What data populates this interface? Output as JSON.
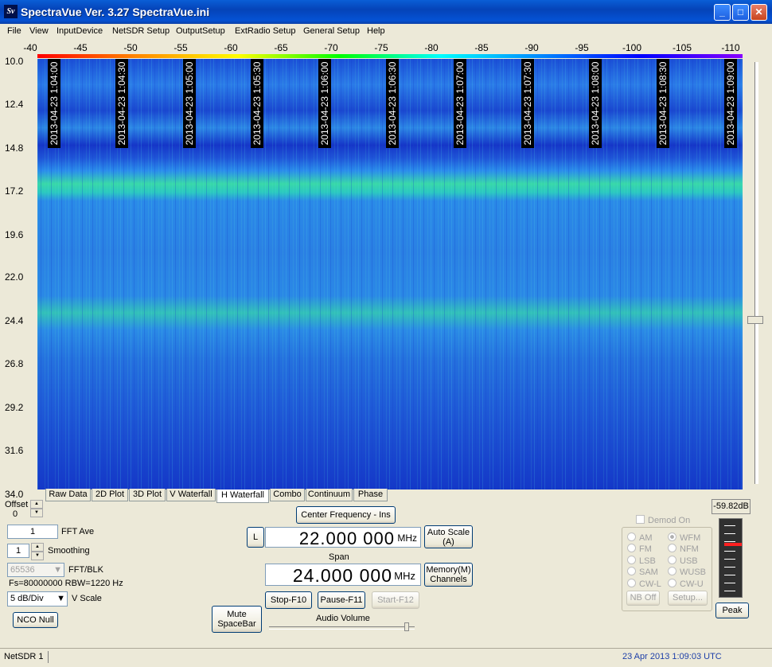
{
  "window": {
    "title": "SpectraVue Ver. 3.27  SpectraVue.ini",
    "icon_text": "Sv",
    "buttons": [
      "minimize-icon",
      "maximize-icon",
      "close-icon"
    ]
  },
  "menu": [
    "File",
    "View",
    "InputDevice",
    "NetSDR Setup",
    "OutputSetup",
    "ExtRadio Setup",
    "General Setup",
    "Help"
  ],
  "freq_axis": [
    "-40",
    "-45",
    "-50",
    "-55",
    "-60",
    "-65",
    "-70",
    "-75",
    "-80",
    "-85",
    "-90",
    "-95",
    "-100",
    "-105",
    "-110"
  ],
  "y_axis": [
    "10.0",
    "12.4",
    "14.8",
    "17.2",
    "19.6",
    "22.0",
    "24.4",
    "26.8",
    "29.2",
    "31.6",
    "34.0"
  ],
  "timestamps": [
    "2013-04-23 1:04:00",
    "2013-04-23 1:04:30",
    "2013-04-23 1:05:00",
    "2013-04-23 1:05:30",
    "2013-04-23 1:06:00",
    "2013-04-23 1:06:30",
    "2013-04-23 1:07:00",
    "2013-04-23 1:07:30",
    "2013-04-23 1:08:00",
    "2013-04-23 1:08:30",
    "2013-04-23 1:09:00"
  ],
  "tabs": [
    "Raw Data",
    "2D Plot",
    "3D Plot",
    "V Waterfall",
    "H Waterfall",
    "Combo",
    "Continuum",
    "Phase"
  ],
  "active_tab": "H Waterfall",
  "controls": {
    "offset_label": "Offset",
    "offset_value": "0",
    "fft_ave_value": "1",
    "fft_ave_label": "FFT Ave",
    "smoothing_value": "1",
    "smoothing_label": "Smoothing",
    "fft_blk_value": "65536",
    "fft_blk_label": "FFT/BLK",
    "fs_info": "Fs=80000000 RBW=1220 Hz",
    "vscale_value": "5 dB/Div",
    "vscale_label": "V Scale",
    "nco_null": "NCO Null",
    "mute_line1": "Mute",
    "mute_line2": "SpaceBar",
    "center_freq_button": "Center Frequency - Ins",
    "l_button": "L",
    "center_freq_value": "22.000 000",
    "center_freq_unit": "MHz",
    "auto_scale_line1": "Auto Scale",
    "auto_scale_line2": "(A)",
    "span_label": "Span",
    "span_value": "24.000 000",
    "span_unit": "MHz",
    "memory_line1": "Memory(M)",
    "memory_line2": "Channels",
    "stop": "Stop-F10",
    "pause": "Pause-F11",
    "start": "Start-F12",
    "audio_volume_label": "Audio Volume",
    "audio_volume_level": 0.96
  },
  "demod": {
    "demod_on": "Demod On",
    "left": [
      "AM",
      "FM",
      "LSB",
      "SAM",
      "CW-L"
    ],
    "right": [
      "WFM",
      "NFM",
      "USB",
      "WUSB",
      "CW-U"
    ],
    "selected": "WFM",
    "nb_off": "NB Off",
    "setup": "Setup..."
  },
  "meter": {
    "value": "-59.82dB",
    "peak": "Peak"
  },
  "status": {
    "left": "NetSDR 1",
    "right": "23 Apr 2013  1:09:03 UTC"
  },
  "colors": {
    "title_blue": "#0552d4",
    "waterfall_blue": "#1a48d0",
    "waterfall_green": "#38d8a8",
    "status_blue": "#1d3fa8",
    "meter_red": "#ff2020"
  }
}
